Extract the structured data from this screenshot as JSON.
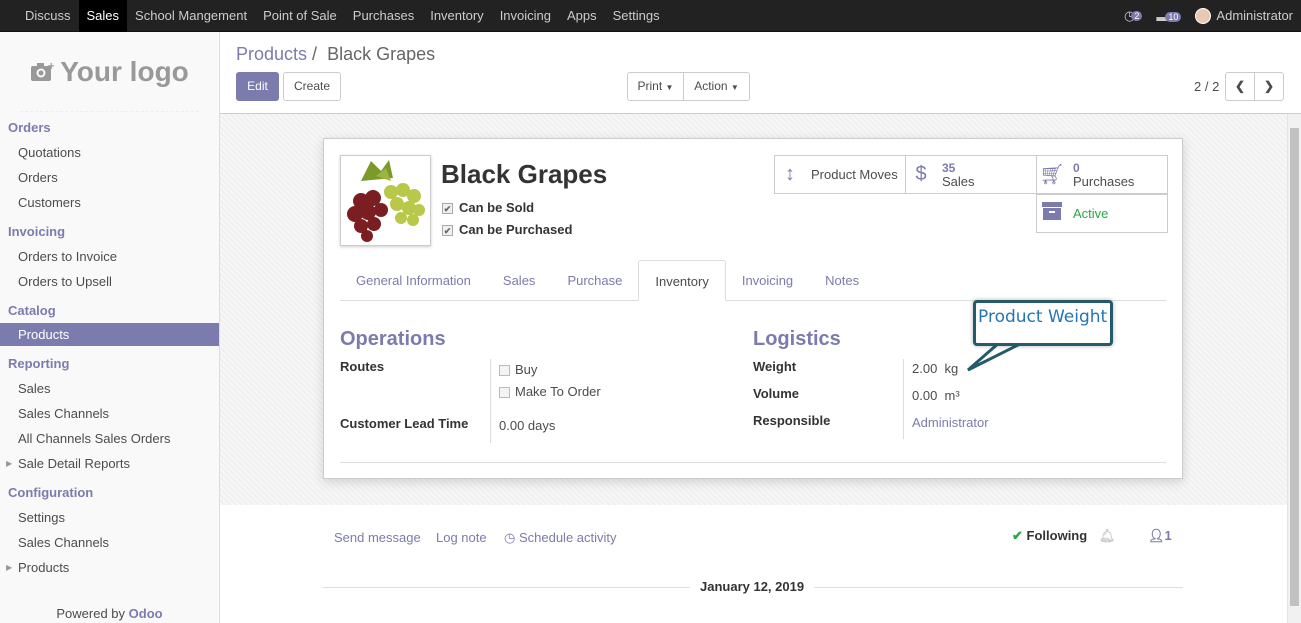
{
  "topbar": {
    "menu": [
      "Discuss",
      "Sales",
      "School Mangement",
      "Point of Sale",
      "Purchases",
      "Inventory",
      "Invoicing",
      "Apps",
      "Settings"
    ],
    "active": "Sales",
    "chat_count": "2",
    "activity_count": "10",
    "user": "Administrator"
  },
  "sidebar": {
    "logo": "Your logo",
    "sections": [
      {
        "title": "Orders",
        "items": [
          "Quotations",
          "Orders",
          "Customers"
        ]
      },
      {
        "title": "Invoicing",
        "items": [
          "Orders to Invoice",
          "Orders to Upsell"
        ]
      },
      {
        "title": "Catalog",
        "items": [
          "Products"
        ]
      },
      {
        "title": "Reporting",
        "items": [
          "Sales",
          "Sales Channels",
          "All Channels Sales Orders",
          "Sale Detail Reports"
        ]
      },
      {
        "title": "Configuration",
        "items": [
          "Settings",
          "Sales Channels",
          "Products"
        ]
      }
    ],
    "powered_prefix": "Powered by ",
    "powered_brand": "Odoo"
  },
  "breadcrumb": {
    "parent": "Products",
    "sep": " / ",
    "current": "Black Grapes"
  },
  "buttons": {
    "edit": "Edit",
    "create": "Create",
    "print": "Print",
    "action": "Action"
  },
  "pager": {
    "value": "2 / 2"
  },
  "product": {
    "name": "Black Grapes",
    "can_be_sold": "Can be Sold",
    "can_be_purchased": "Can be Purchased"
  },
  "smart_buttons": {
    "moves": "Product Moves",
    "sales_count": "35",
    "sales_label": "Sales",
    "purchases_count": "0",
    "purchases_label": "Purchases",
    "active": "Active"
  },
  "tabs": [
    "General Information",
    "Sales",
    "Purchase",
    "Inventory",
    "Invoicing",
    "Notes"
  ],
  "active_tab": "Inventory",
  "operations": {
    "title": "Operations",
    "routes_label": "Routes",
    "route_buy": "Buy",
    "route_mto": "Make To Order",
    "lead_label": "Customer Lead Time",
    "lead_value": "0.00 days"
  },
  "logistics": {
    "title": "Logistics",
    "weight_label": "Weight",
    "weight_value": "2.00  kg",
    "volume_label": "Volume",
    "volume_value": "0.00  m³",
    "responsible_label": "Responsible",
    "responsible_value": "Administrator"
  },
  "callout": "Product Weight",
  "chatter": {
    "send": "Send message",
    "log": "Log note",
    "schedule": "Schedule activity",
    "following": "Following",
    "followers": "1",
    "date": "January 12, 2019"
  },
  "colors": {
    "accent": "#7c7bad",
    "topbar": "#222222",
    "callout_border": "#245b6b"
  }
}
